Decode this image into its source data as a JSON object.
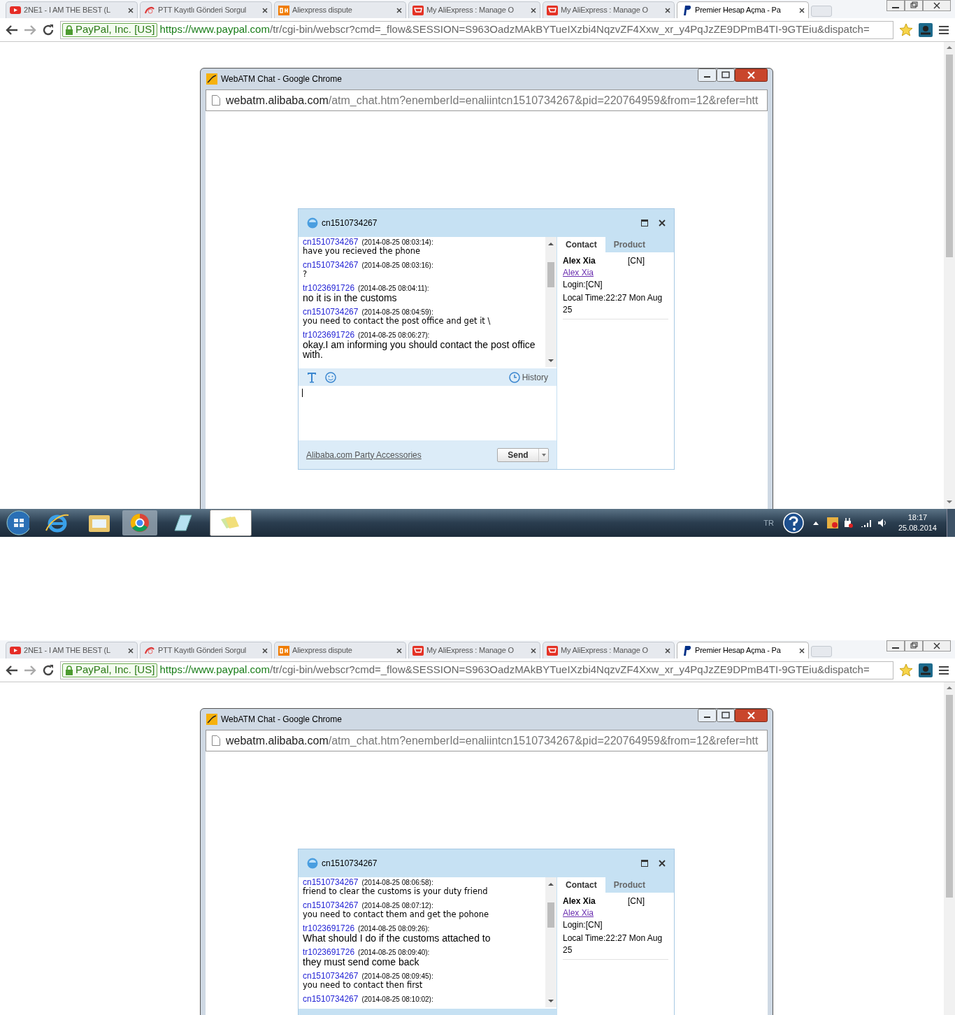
{
  "screens": [
    {
      "browser": {
        "tabs": [
          {
            "title": "2NE1 - I AM THE BEST (L",
            "selected": false
          },
          {
            "title": "PTT Kayıtlı Gönderi Sorgul",
            "selected": false
          },
          {
            "title": "Aliexpress dispute",
            "selected": false
          },
          {
            "title": "My AliExpress : Manage O",
            "selected": false
          },
          {
            "title": "My AliExpress : Manage O",
            "selected": false
          },
          {
            "title": "Premier Hesap Açma - Pa",
            "selected": true
          }
        ],
        "security_badge": "PayPal, Inc. [US]",
        "url_host": "https://www.paypal.com",
        "url_path": "/tr/cgi-bin/webscr?cmd=_flow&SESSION=S963OadzMAkBYTueIXzbi4NqzvZF4Xxw_xr_y4PqJzZE9DPmB4TI-9GTEiu&dispatch="
      },
      "popup": {
        "title": "WebATM Chat - Google Chrome",
        "url_host": "webatm.alibaba.com",
        "url_path": "/atm_chat.htm?enemberId=enaliintcn1510734267&pid=220764959&from=12&refer=htt",
        "chat": {
          "title": "cn1510734267",
          "messages": [
            {
              "kind": "received",
              "sender": "cn1510734267",
              "time": "(2014-08-25 08:03:14):",
              "text": "have you recieved the phone"
            },
            {
              "kind": "received",
              "sender": "cn1510734267",
              "time": "(2014-08-25 08:03:16):",
              "text": "?"
            },
            {
              "kind": "sent",
              "sender": "tr1023691726",
              "time": "(2014-08-25 08:04:11):",
              "text": "no it is in the customs"
            },
            {
              "kind": "received",
              "sender": "cn1510734267",
              "time": "(2014-08-25 08:04:59):",
              "text": "you need to contact the post office and get it \\"
            },
            {
              "kind": "sent",
              "sender": "tr1023691726",
              "time": "(2014-08-25 08:06:27):",
              "text": "okay.I am informing you should contact the post office with."
            }
          ],
          "history": "History",
          "footer_link": "Alibaba.com Party Accessories",
          "send": "Send",
          "side_tabs": [
            {
              "label": "Contact",
              "selected": true
            },
            {
              "label": "Product",
              "selected": false
            }
          ],
          "contact": {
            "name": "Alex Xia",
            "country": "[CN]",
            "link": "Alex Xia",
            "login": "Login:[CN]",
            "local_time": "Local Time:22:27 Mon Aug 25"
          }
        }
      },
      "taskbar": {
        "language": "TR",
        "time": "18:17",
        "date": "25.08.2014"
      }
    },
    {
      "browser": {
        "tabs": [
          {
            "title": "2NE1 - I AM THE BEST (L",
            "selected": false
          },
          {
            "title": "PTT Kayıtlı Gönderi Sorgul",
            "selected": false
          },
          {
            "title": "Aliexpress dispute",
            "selected": false
          },
          {
            "title": "My AliExpress : Manage O",
            "selected": false
          },
          {
            "title": "My AliExpress : Manage O",
            "selected": false
          },
          {
            "title": "Premier Hesap Açma - Pa",
            "selected": true
          }
        ],
        "security_badge": "PayPal, Inc. [US]",
        "url_host": "https://www.paypal.com",
        "url_path": "/tr/cgi-bin/webscr?cmd=_flow&SESSION=S963OadzMAkBYTueIXzbi4NqzvZF4Xxw_xr_y4PqJzZE9DPmB4TI-9GTEiu&dispatch="
      },
      "popup": {
        "title": "WebATM Chat - Google Chrome",
        "url_host": "webatm.alibaba.com",
        "url_path": "/atm_chat.htm?enemberId=enaliintcn1510734267&pid=220764959&from=12&refer=htt",
        "chat": {
          "title": "cn1510734267",
          "messages": [
            {
              "kind": "received",
              "sender": "cn1510734267",
              "time": "(2014-08-25 08:06:58):",
              "text": "friend to clear the customs is your duty friend"
            },
            {
              "kind": "received",
              "sender": "cn1510734267",
              "time": "(2014-08-25 08:07:12):",
              "text": "you need to contact them and get the pohone"
            },
            {
              "kind": "sent",
              "sender": "tr1023691726",
              "time": "(2014-08-25 08:09:26):",
              "text": "What should I do if the customs attached to"
            },
            {
              "kind": "sent",
              "sender": "tr1023691726",
              "time": "(2014-08-25 08:09:40):",
              "text": "they must send come back"
            },
            {
              "kind": "received",
              "sender": "cn1510734267",
              "time": "(2014-08-25 08:09:45):",
              "text": "you need to contact then first"
            },
            {
              "sender": "cn1510734267",
              "time": "(2014-08-25 08:10:02):"
            }
          ],
          "side_tabs": [
            {
              "label": "Contact",
              "selected": true
            },
            {
              "label": "Product",
              "selected": false
            }
          ],
          "contact": {
            "name": "Alex Xia",
            "country": "[CN]",
            "link": "Alex Xia",
            "login": "Login:[CN]",
            "local_time": "Local Time:22:27 Mon Aug 25"
          }
        }
      }
    }
  ]
}
